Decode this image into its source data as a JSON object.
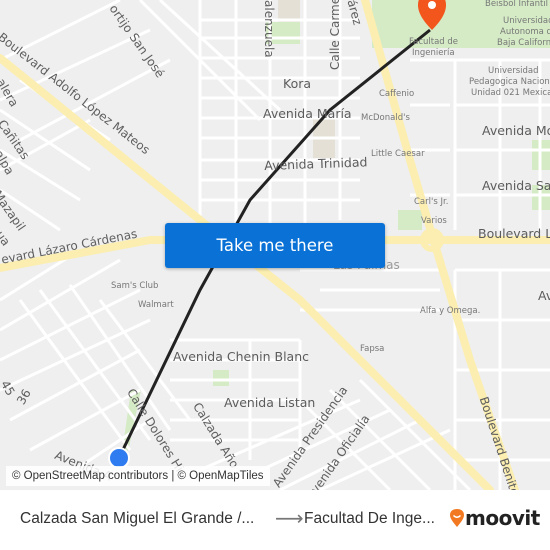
{
  "map": {
    "labels": {
      "blvd_lopez_mateos": "Boulevard Adolfo López Mateos",
      "cortijo_san_jose": "ortijo San José",
      "valenzuela": "alenzuela",
      "calle_carmen": "Calle Carme",
      "juarez": "árez",
      "kora": "Kora",
      "avenida_maria": "Avenida María",
      "avenida_trinidad": "Avenida Trinidad",
      "avenida_mo": "Avenida Mo",
      "avenida_sal": "Avenida Sal",
      "blvd_lazaro_cardenas": "evard Lázaro Cárdenas",
      "blvd_la": "Boulevard La",
      "las_palmas": "Las Palmas",
      "av_right": "Av",
      "avenida_chenin_blanc": "Avenida Chenin Blanc",
      "avenida_listan": "Avenida Listan",
      "calzada_ano": "Calzada Año",
      "calle_dolores": "Calle Dolores Hi",
      "avenida_presidencia": "Avenida Presidencia",
      "avenida_oficialia": "venida Oficialía",
      "avenida_bottom": "Avenida A",
      "blvd_benito": "Boulevard Benito",
      "galera": "alera",
      "canitas": "e Cañitas",
      "alpa": "alpa",
      "mazapil": "Mazapil",
      "hua": "hua",
      "n45": "45",
      "n36": "36"
    },
    "pois": {
      "beisbol": "Beisbol Infantil",
      "uabc_1": "Universidad",
      "uabc_2": "Autonoma de",
      "uabc_3": "Baja California",
      "facultad_1": "Facultad de",
      "facultad_2": "Ingeniería",
      "upn_1": "Universidad",
      "upn_2": "Pedagogica Nacional",
      "upn_3": "Unidad 021 Mexicali",
      "caffenio": "Caffenio",
      "mcdonalds": "McDonald's",
      "little_caesar": "Little Caesar",
      "carls_jr": "Carl's Jr.",
      "varios": "Varios",
      "sams_club": "Sam's Club",
      "walmart": "Walmart",
      "alfa_omega": "Alfa y Omega.",
      "fapsa": "Fapsa"
    },
    "cta_label": "Take me there",
    "attribution": "© OpenStreetMap contributors | © OpenMapTiles",
    "colors": {
      "route": "#222222",
      "origin": "#2f7cf0",
      "destination": "#f2561d",
      "cta": "#0a72d6",
      "major_road": "#fbeeb0",
      "park": "#cfe8bf"
    }
  },
  "footer": {
    "origin": "Calzada San Miguel El Grande /...",
    "arrow": "⟶",
    "destination": "Facultad De Inge...",
    "brand": "moovit",
    "brand_color": "#f27921"
  }
}
